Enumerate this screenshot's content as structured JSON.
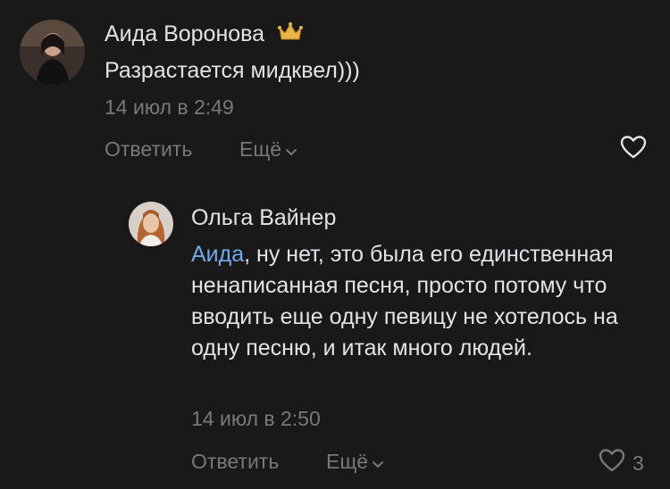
{
  "comments": [
    {
      "author": "Аида Воронова",
      "badge_icon": "crown-icon",
      "text": "Разрастается мидквел)))",
      "timestamp": "14 июл в 2:49",
      "reply_label": "Ответить",
      "more_label": "Ещё",
      "likes": ""
    },
    {
      "author": "Ольга Вайнер",
      "mention": "Аида",
      "text": ", ну нет, это была его единственная ненаписанная песня, просто потому что вводить еще одну певицу не хотелось на одну песню, и итак много людей.",
      "timestamp": "14 июл в 2:50",
      "reply_label": "Ответить",
      "more_label": "Ещё",
      "likes": "3"
    }
  ],
  "colors": {
    "background": "#191919",
    "text": "#e1e3e6",
    "secondary": "#76787a",
    "link": "#71aaeb",
    "crown": "#e9b546"
  }
}
